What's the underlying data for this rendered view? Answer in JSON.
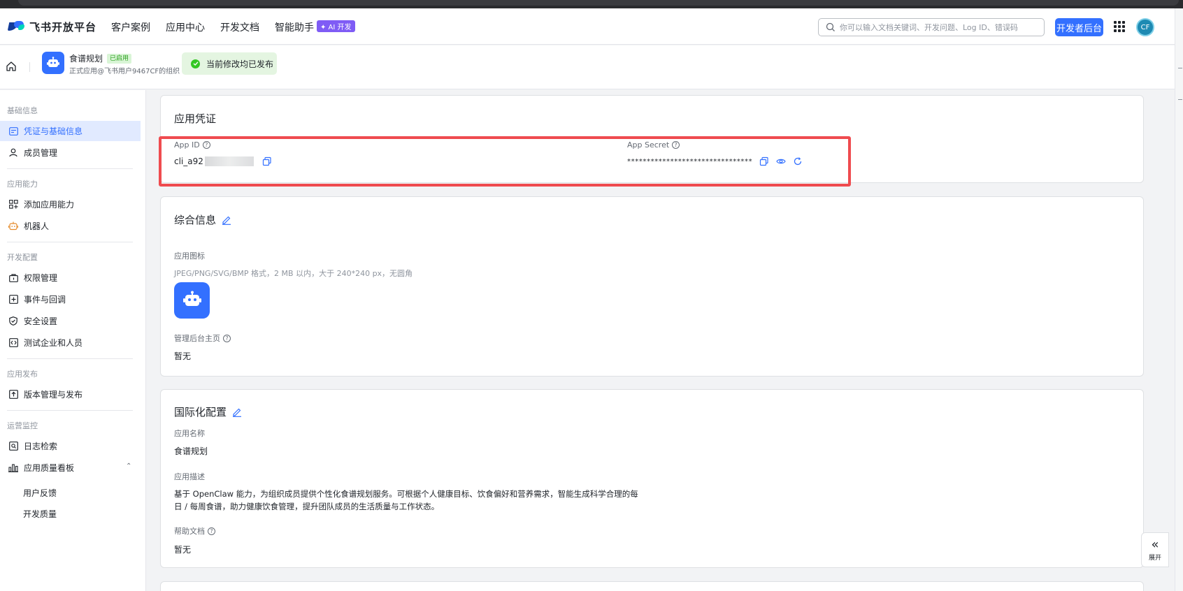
{
  "topnav": {
    "logo_text": "飞书开放平台",
    "links": [
      "客户案例",
      "应用中心",
      "开发文档",
      "智能助手"
    ],
    "ai_badge": "✦ AI 开发",
    "search_placeholder": "你可以输入文档关键词、开发问题、Log ID、错误码",
    "dev_console_button": "开发者后台",
    "avatar_initials": "CF"
  },
  "subheader": {
    "app_name": "食谱规划",
    "status_tag": "已启用",
    "app_subtitle": "正式应用@飞书用户9467CF的组织",
    "publish_banner": "当前修改均已发布"
  },
  "sidebar": {
    "sections": [
      {
        "title": "基础信息",
        "items": [
          "凭证与基础信息",
          "成员管理"
        ]
      },
      {
        "title": "应用能力",
        "items": [
          "添加应用能力",
          "机器人"
        ]
      },
      {
        "title": "开发配置",
        "items": [
          "权限管理",
          "事件与回调",
          "安全设置",
          "测试企业和人员"
        ]
      },
      {
        "title": "应用发布",
        "items": [
          "版本管理与发布"
        ]
      },
      {
        "title": "运营监控",
        "items": [
          "日志检索",
          "应用质量看板"
        ]
      }
    ],
    "sub_items": [
      "用户反馈",
      "开发质量"
    ]
  },
  "credentials": {
    "title": "应用凭证",
    "app_id_label": "App ID",
    "app_id_value": "cli_a92",
    "app_secret_label": "App Secret",
    "app_secret_value": "********************************"
  },
  "general": {
    "title": "综合信息",
    "icon_label": "应用图标",
    "icon_hint": "JPEG/PNG/SVG/BMP 格式，2 MB 以内，大于 240*240 px，无圆角",
    "admin_home_label": "管理后台主页",
    "admin_home_value": "暂无"
  },
  "i18n": {
    "title": "国际化配置",
    "name_label": "应用名称",
    "name_value": "食谱规划",
    "desc_label": "应用描述",
    "desc_line1": "基于 OpenClaw 能力，为组织成员提供个性化食谱规划服务。可根据个人健康目标、饮食偏好和营养需求，智能生成科学合理的每",
    "desc_line2": "日 / 每周食谱，助力健康饮食管理，提升团队成员的生活质量与工作状态。",
    "help_label": "帮助文档",
    "help_value": "暂无"
  },
  "expand_button": "展开",
  "colors": {
    "accent": "#3370ff",
    "highlight": "#ef4b4f",
    "success": "#34c724"
  }
}
